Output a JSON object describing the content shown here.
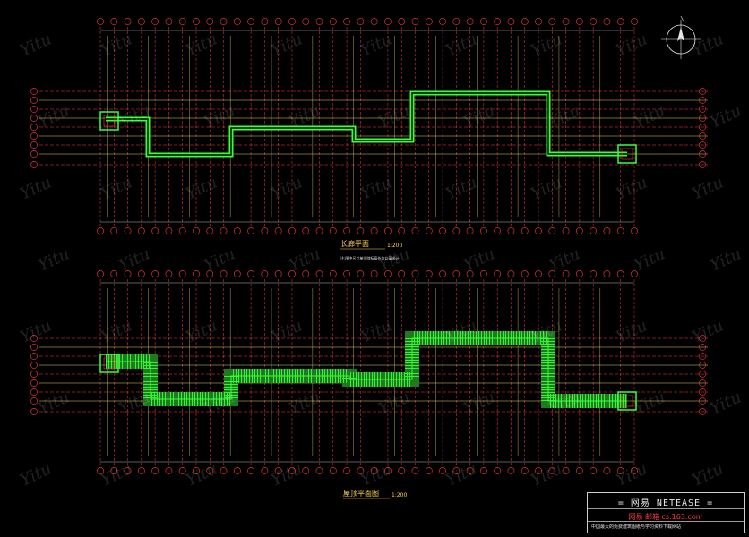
{
  "top_plan": {
    "title": "长廊平面",
    "scale": "1:200",
    "note": "注:图中尺寸单位除标高外均以毫米计"
  },
  "roof_plan": {
    "title": "屋顶平面图",
    "scale": "1:200"
  },
  "title_block": {
    "brand": "= 网易 NETEASE =",
    "site": "网易 邮箱 cs.163.com",
    "footer": "中国最大的免费建筑图纸与学习资料下载网站"
  },
  "watermark": "Yitu",
  "colors": {
    "background": "#000000",
    "grid_red": "#ff3b3b",
    "grid_yellow": "#e6d15a",
    "path_green": "#39ff3a",
    "label_white": "#e8e8e8",
    "accent_cyan": "#36c8ff"
  },
  "icons": {
    "north_arrow": "compass-icon"
  }
}
